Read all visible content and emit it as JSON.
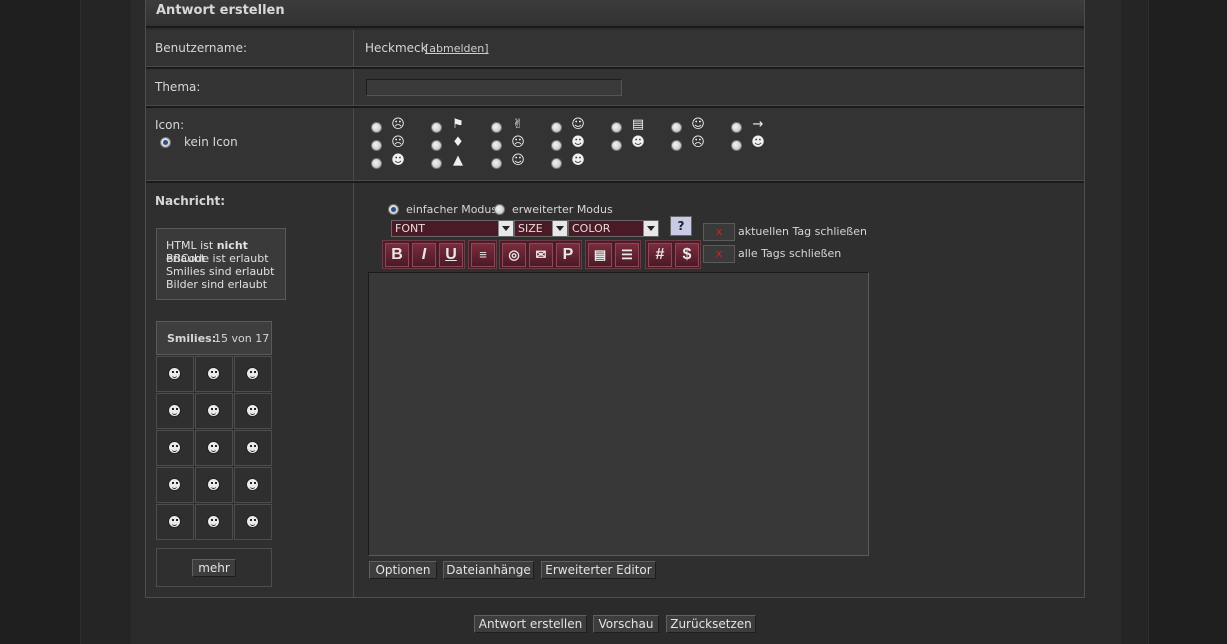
{
  "header": {
    "title": "Antwort erstellen"
  },
  "username": {
    "label": "Benutzername:",
    "value": "Heckmeck",
    "logout_link": "[abmelden]"
  },
  "subject": {
    "label": "Thema:",
    "value": ""
  },
  "icon": {
    "label": "Icon:",
    "no_icon_label": "kein Icon",
    "no_icon_selected": true,
    "options": [
      "shock-icon",
      "checkered-flag-icon",
      "thumbs-up-icon",
      "grin-icon",
      "document-icon",
      "smile-icon",
      "arrow-right-icon",
      "grimace-icon",
      "lightbulb-icon",
      "sad-icon",
      "surprised-icon",
      "cool-icon",
      "angry-icon",
      "laugh-icon",
      "question-icon",
      "warning-icon",
      "happy-icon",
      "big-grin-icon"
    ]
  },
  "message": {
    "label": "Nachricht:",
    "info": {
      "html_prefix": "HTML ist ",
      "html_bold": "nicht",
      "html_suffix": " erlaubt",
      "bbcode": "BBCode ist erlaubt",
      "smilies": "Smilies sind erlaubt",
      "images": "Bilder sind erlaubt"
    },
    "smilies": {
      "label": "Smilies:",
      "count": "15 von 17",
      "more_button": "mehr",
      "items": [
        "laughing-smiley-icon",
        "wink-smiley-icon",
        "grimace-smiley-icon",
        "cool-smiley-icon",
        "smile-smiley-icon",
        "tongue-smiley-icon",
        "happy-smiley-icon",
        "frown-smiley-icon",
        "surprised-smiley-icon",
        "sad-smiley-icon",
        "grin-smiley-icon",
        "shocked-smiley-icon",
        "scream-smiley-icon",
        "sunglasses-smiley-icon",
        "confused-smiley-icon"
      ]
    }
  },
  "editor": {
    "mode_simple": "einfacher Modus",
    "mode_advanced": "erweiterter Modus",
    "selected_mode": "simple",
    "font_select": "FONT",
    "size_select": "SIZE",
    "color_select": "COLOR",
    "close_current_tag": "aktuellen Tag schließen",
    "close_all_tags": "alle Tags schließen",
    "close_button": "x",
    "toolbar": {
      "bold": "B",
      "italic": "I",
      "underline": "U",
      "hash": "#",
      "dollar": "$",
      "p": "P"
    },
    "textarea_value": "",
    "buttons": {
      "options": "Optionen",
      "attachments": "Dateianhänge",
      "advanced_editor": "Erweiterter Editor"
    }
  },
  "actions": {
    "submit": "Antwort erstellen",
    "preview": "Vorschau",
    "reset": "Zurücksetzen"
  },
  "colors": {
    "toolbar": "#4b1c27",
    "select_bg": "#4a1b26",
    "background": "#2c2c2c"
  }
}
